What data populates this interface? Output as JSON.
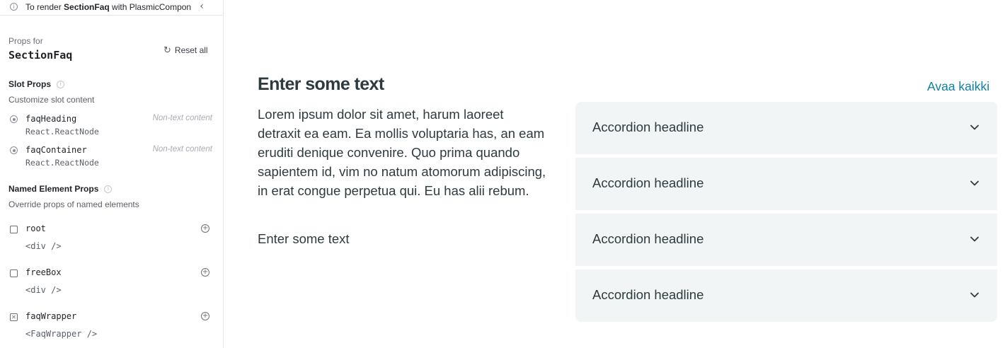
{
  "notice": {
    "prefix": "To render ",
    "component": "SectionFaq",
    "suffix": " with PlasmicComponent"
  },
  "header": {
    "props_for_label": "Props for",
    "component_name": "SectionFaq",
    "reset_label": "Reset all"
  },
  "slot_props": {
    "title": "Slot Props",
    "description": "Customize slot content",
    "items": [
      {
        "name": "faqHeading",
        "type": "React.ReactNode",
        "value": "Non-text content"
      },
      {
        "name": "faqContainer",
        "type": "React.ReactNode",
        "value": "Non-text content"
      }
    ]
  },
  "named_element_props": {
    "title": "Named Element Props",
    "description": "Override props of named elements",
    "items": [
      {
        "name": "root",
        "tag": "<div />"
      },
      {
        "name": "freeBox",
        "tag": "<div />"
      },
      {
        "name": "faqWrapper",
        "tag": "<FaqWrapper />"
      }
    ]
  },
  "preview": {
    "heading": "Enter some text",
    "body": "Lorem ipsum dolor sit amet, harum laoreet detraxit ea eam. Ea mollis voluptaria has, an eam eruditi denique convenire. Quo prima quando sapientem id, vim no natum atomorum adipiscing, in erat congue perpetua qui. Eu has alii rebum.",
    "subtext": "Enter some text",
    "open_all_label": "Avaa kaikki",
    "accordions": [
      {
        "title": "Accordion headline"
      },
      {
        "title": "Accordion headline"
      },
      {
        "title": "Accordion headline"
      },
      {
        "title": "Accordion headline"
      }
    ]
  },
  "icons": {
    "info": "info-icon",
    "collapse": "chevron-left-icon",
    "reset": "reset-icon",
    "help": "help-icon",
    "slot": "radio-icon",
    "element": "checkbox-icon",
    "add": "add-icon",
    "accordion": "chevron-down-icon"
  },
  "colors": {
    "accent_link": "#11809e",
    "accordion_bg": "#f2f5f5",
    "text_dark": "#2f3a3f"
  }
}
